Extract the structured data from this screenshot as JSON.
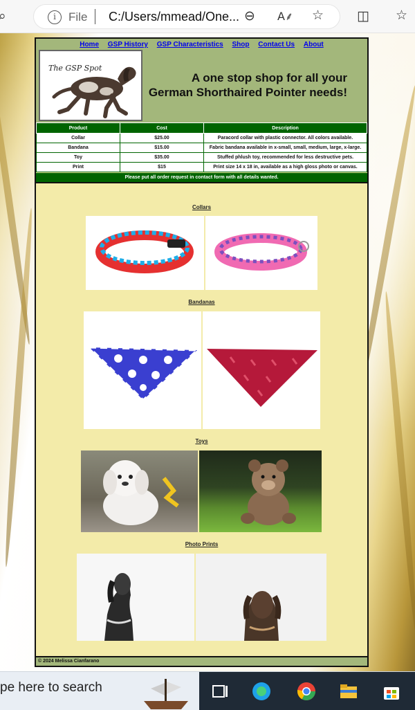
{
  "browser": {
    "file_label": "File",
    "url": "C:/Users/mmead/One...",
    "zoom_icon": "zoom-out-icon",
    "read_icon": "read-aloud-icon",
    "fav_icon": "favorite-star-icon"
  },
  "nav": {
    "items": [
      "Home",
      "GSP History",
      "GSP Characteristics",
      "Shop",
      "Contact Us",
      "About"
    ]
  },
  "header": {
    "logo_text": "The GSP Spot",
    "tagline_line1": "A one stop shop for all your",
    "tagline_line2": "German Shorthaired Pointer needs!"
  },
  "price_table": {
    "headers": [
      "Product",
      "Cost",
      "Description"
    ],
    "rows": [
      [
        "Collar",
        "$25.00",
        "Paracord collar with plastic connector. All colors available."
      ],
      [
        "Bandana",
        "$15.00",
        "Fabric bandana available in x-small, small, medium, large, x-large."
      ],
      [
        "Toy",
        "$35.00",
        "Stuffed phlush toy, recommended for less destructive pets."
      ],
      [
        "Print",
        "$15",
        "Print size 14 x 18 in, available as a high gloss photo or canvas."
      ]
    ],
    "notice": "Please put all order request in contact form with all details wanted."
  },
  "sections": {
    "collars": "Collars",
    "bandanas": "Bandanas",
    "toys": "Toys",
    "prints": "Photo Prints"
  },
  "footer": {
    "text": "© 2024 Melissa Cianfarano"
  },
  "taskbar": {
    "search_text": "pe here to search"
  },
  "colors": {
    "header_green": "#a3b77b",
    "table_green": "#006400",
    "content_bg": "#f3eba9"
  }
}
